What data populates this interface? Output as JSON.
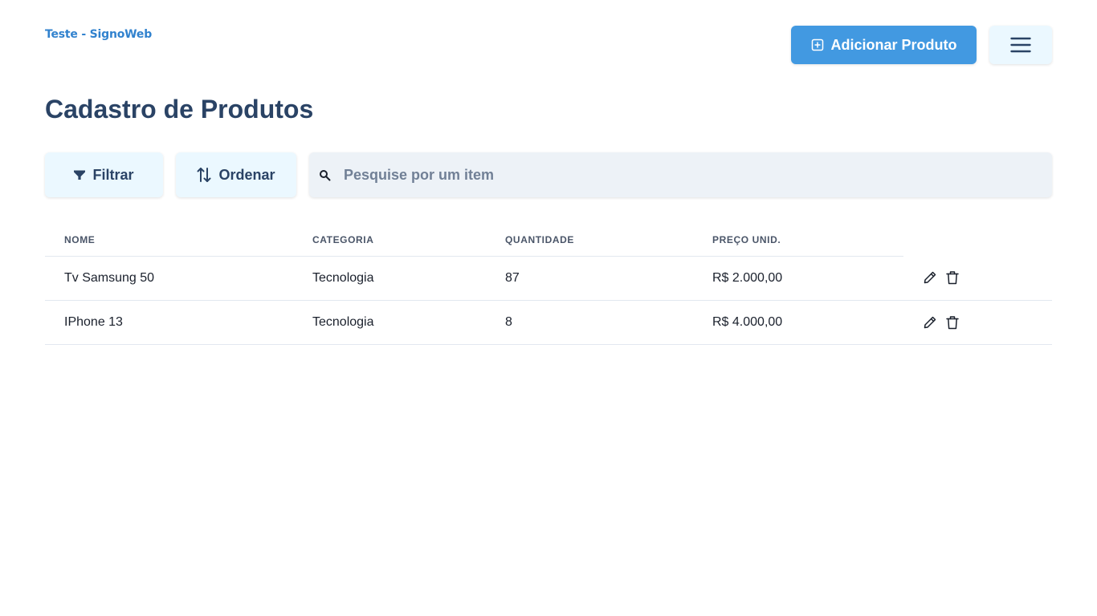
{
  "brand": "Teste - SignoWeb",
  "header": {
    "add_button": "Adicionar Produto",
    "add_icon": "plus-square-icon",
    "menu_icon": "hamburger-menu-icon"
  },
  "page_title": "Cadastro de Produtos",
  "toolbar": {
    "filter_label": "Filtrar",
    "order_label": "Ordenar",
    "search_placeholder": "Pesquise por um item",
    "search_value": ""
  },
  "table": {
    "columns": [
      "NOME",
      "CATEGORIA",
      "QUANTIDADE",
      "PREÇO UNID."
    ],
    "rows": [
      {
        "nome": "Tv Samsung 50",
        "categoria": "Tecnologia",
        "quantidade": "87",
        "preco": "R$ 2.000,00"
      },
      {
        "nome": "IPhone 13",
        "categoria": "Tecnologia",
        "quantidade": "8",
        "preco": "R$ 4.000,00"
      }
    ],
    "row_actions": [
      "edit-icon",
      "trash-icon"
    ]
  },
  "colors": {
    "primary": "#4299e1",
    "brand": "#3182ce",
    "title": "#2a4365",
    "light_button_bg": "#ebf8ff",
    "search_bg": "#edf2f7"
  }
}
